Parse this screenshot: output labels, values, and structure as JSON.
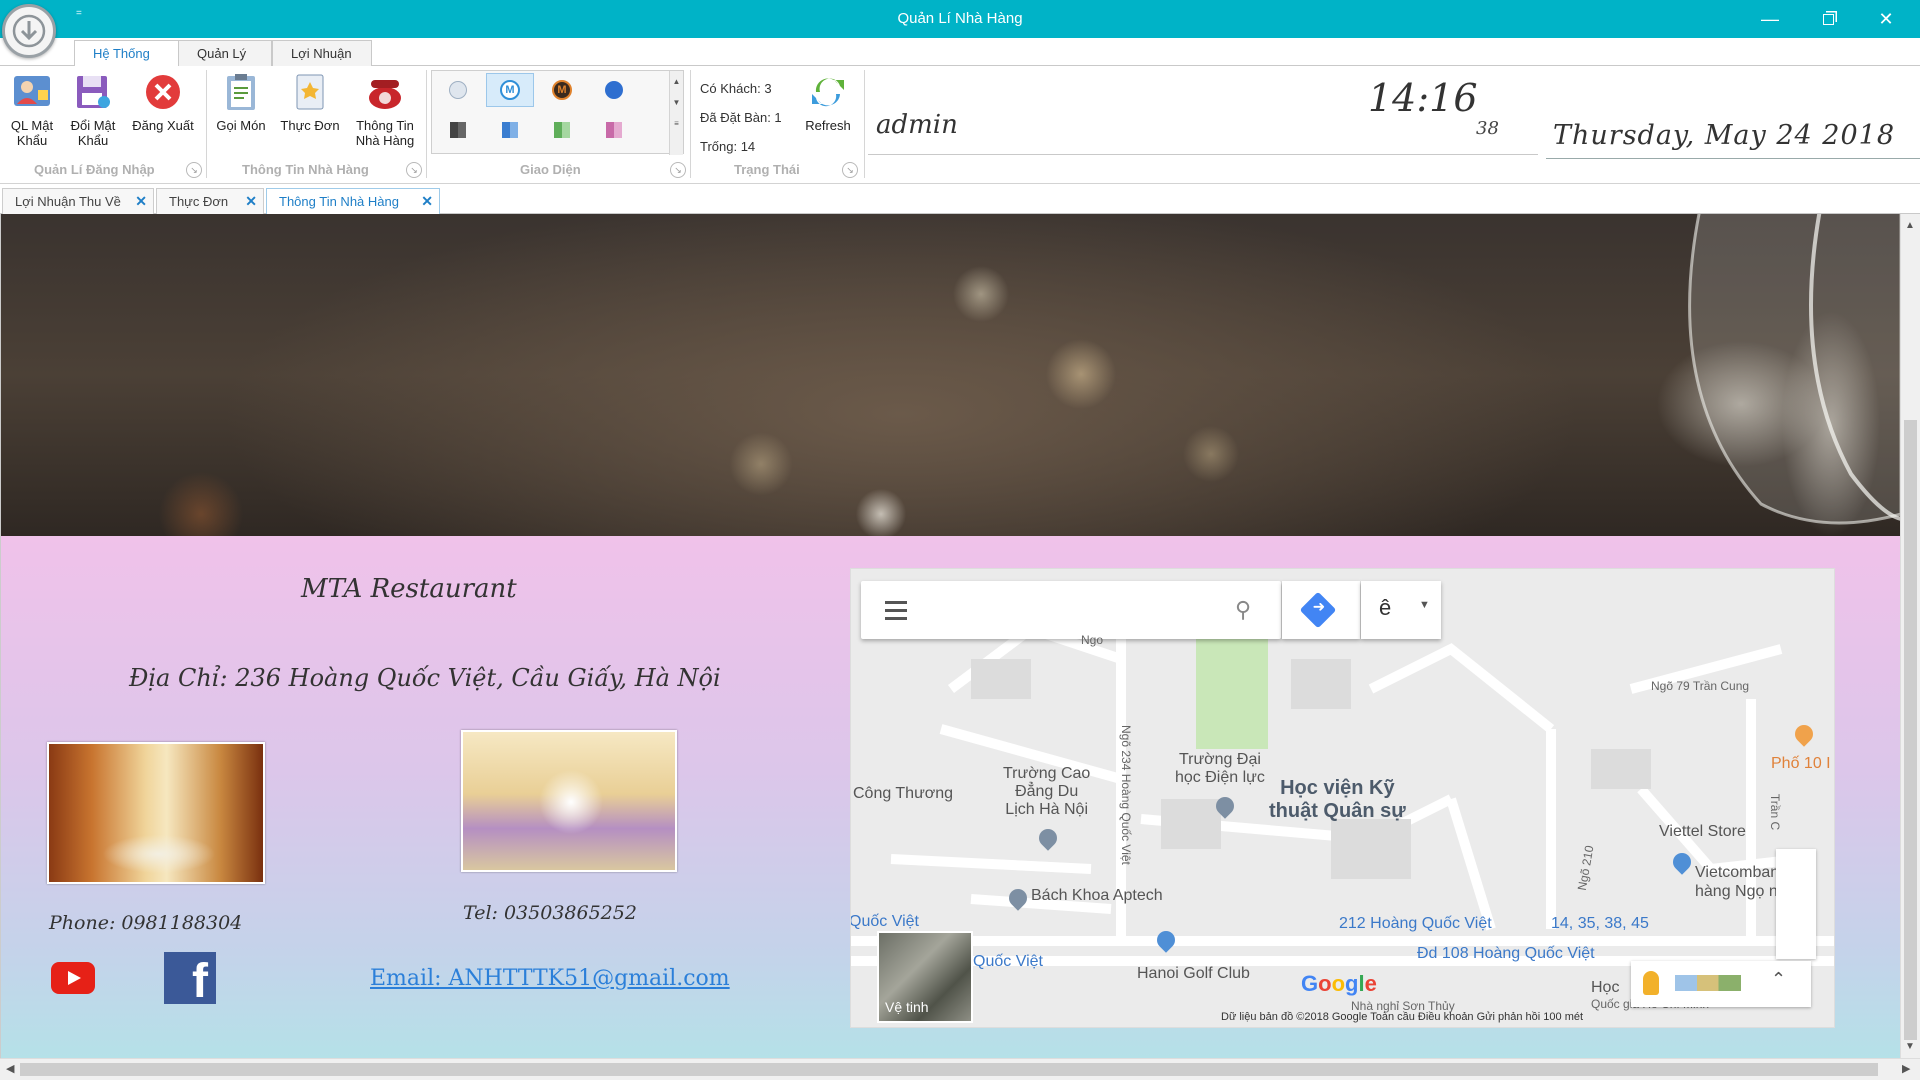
{
  "window": {
    "title": "Quản Lí Nhà Hàng",
    "qat_marker": "="
  },
  "ribbon_tabs": [
    "Hệ Thống",
    "Quản Lý",
    "Lợi Nhuận"
  ],
  "ribbon": {
    "buttons": {
      "ql_mat_khau": "QL Mật\nKhẩu",
      "doi_mat_khau": "Đổi Mật\nKhẩu",
      "dang_xuat": "Đăng Xuất",
      "goi_mon": "Gọi Món",
      "thuc_don": "Thực Đơn",
      "thong_tin": "Thông Tin\nNhà Hàng",
      "refresh": "Refresh"
    },
    "groups": [
      "Quản Lí Đăng Nhập",
      "Thông Tin Nhà Hàng",
      "Giao Diện",
      "Trạng Thái"
    ],
    "status": {
      "co_khach": "Có Khách: 3",
      "da_dat_ban": "Đã Đặt Bàn: 1",
      "trong": "Trống: 14"
    },
    "user": "admin",
    "time": "14:16",
    "seconds": "38",
    "date": "Thursday, May 24 2018"
  },
  "doc_tabs": [
    "Lợi Nhuận Thu Về",
    "Thực Đơn",
    "Thông Tin Nhà Hàng"
  ],
  "restaurant": {
    "name": "MTA Restaurant",
    "address": "Địa Chỉ: 236 Hoàng Quốc Việt, Cầu Giấy, Hà Nội",
    "phone": "Phone: 0981188304",
    "tel": "Tel: 03503865252",
    "email": "Email: ANHTTTK51@gmail.com",
    "facebook_glyph": "f"
  },
  "map": {
    "lang": "ê",
    "labels": {
      "cong_thuong": "Công Thương",
      "truong_cao_dang": "Trường Cao\nĐẳng Du\nLịch Hà Nội",
      "truong_dai_hoc": "Trường Đại\nhọc Điện lực",
      "hoc_vien": "Học viện Kỹ\nthuật Quân sự",
      "ngo_79": "Ngõ 79 Trần Cung",
      "pho_10": "Phố 10 I",
      "viettel": "Viettel Store",
      "vietcombank": "Vietcombank N\nhàng Ngọ   nươ",
      "bach_khoa": "Bách Khoa Aptech",
      "quoc_viet_1": "Quốc Việt",
      "quoc_viet_2": "Quốc Việt",
      "hoang_quoc_viet_212": "212 Hoàng Quốc Việt",
      "bus": "14, 35, 38, 45",
      "dd108": "Đd 108 Hoàng Quốc Việt",
      "golf": "Hanoi Golf Club",
      "hoc": "Học",
      "quoc_gia": "Quốc gia Hồ Chí Minh",
      "nha_nghi": "Nhà nghỉ Sơn Thủy",
      "ngo_234": "Ngõ 234 Hoàng Quốc Việt",
      "ngo_210": "Ngõ 210",
      "tran_c": "Trần C",
      "ngo": "Ngo"
    },
    "satellite": "Vệ tinh",
    "google": "Google",
    "footer": "Dữ liệu bản đồ ©2018 Google    Toàn cầu    Điều khoản    Gửi phản hồi    100 mét"
  }
}
